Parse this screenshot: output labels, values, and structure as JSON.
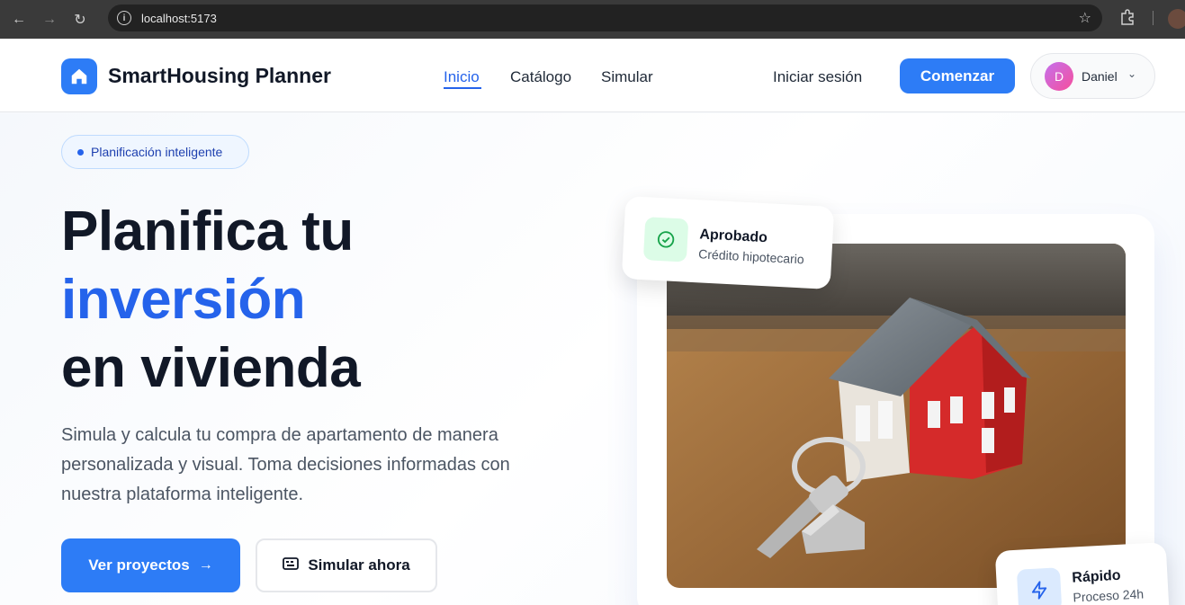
{
  "browser": {
    "url": "localhost:5173"
  },
  "header": {
    "brand": "SmartHousing Planner",
    "nav": [
      {
        "label": "Inicio",
        "active": true
      },
      {
        "label": "Catálogo",
        "active": false
      },
      {
        "label": "Simular",
        "active": false
      }
    ],
    "login_label": "Iniciar sesión",
    "start_label": "Comenzar",
    "user": {
      "initial": "D",
      "name": "Daniel"
    }
  },
  "hero": {
    "badge": "Planificación inteligente",
    "title_line1": "Planifica tu",
    "title_line2": "inversión",
    "title_line3": "en vivienda",
    "lead": "Simula y calcula tu compra de apartamento de manera personalizada y visual. Toma decisiones informadas con nuestra plataforma inteligente.",
    "primary_button": "Ver proyectos",
    "secondary_button": "Simular ahora"
  },
  "cards": {
    "approved": {
      "title": "Aprobado",
      "subtitle": "Crédito hipotecario"
    },
    "fast": {
      "title": "Rápido",
      "subtitle": "Proceso 24h"
    }
  },
  "colors": {
    "accent": "#2d7cf6",
    "heading": "#111827",
    "success_bg": "#dcfce7"
  }
}
